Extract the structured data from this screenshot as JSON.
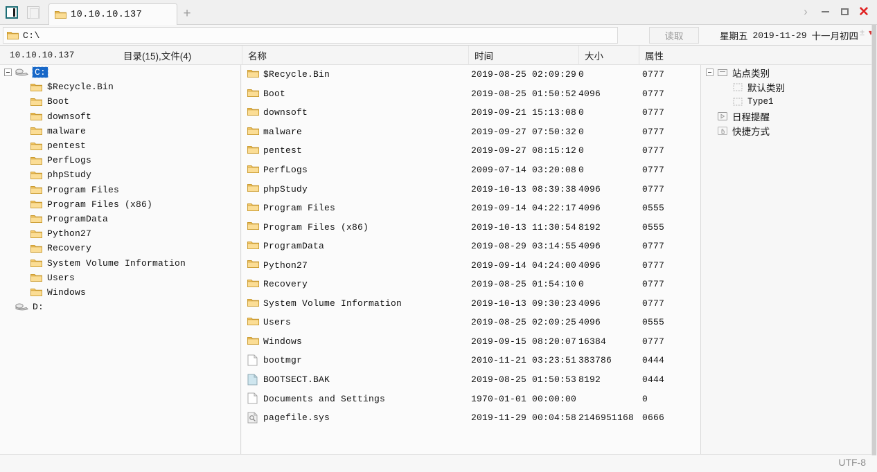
{
  "titlebar": {
    "panel_toggle_icon": "panel-left-icon",
    "panel_toggle2_icon": "panel-right-icon",
    "tab_icon": "folder-icon",
    "tab_label": "10.10.10.137",
    "new_tab_label": "+",
    "chevron_icon": "chevron-right-icon",
    "minimize_label": "minimize-icon",
    "maximize_label": "maximize-icon",
    "close_label": "✕"
  },
  "address": {
    "folder_icon": "folder-icon",
    "path": "C:\\",
    "plusminus": "±",
    "caret": "▾",
    "read_button": "读取"
  },
  "datebar": {
    "weekday": "星期五",
    "date": "2019-11-29",
    "lunar": "十一月初四"
  },
  "columns": {
    "host": "10.10.10.137",
    "counts": "目录(15),文件(4)",
    "name": "名称",
    "time": "时间",
    "size": "大小",
    "attr": "属性"
  },
  "tree": {
    "root": {
      "label": "C:",
      "icon": "drive-icon",
      "selected": true
    },
    "children": [
      {
        "label": "$Recycle.Bin",
        "icon": "folder-icon"
      },
      {
        "label": "Boot",
        "icon": "folder-icon"
      },
      {
        "label": "downsoft",
        "icon": "folder-icon"
      },
      {
        "label": "malware",
        "icon": "folder-icon"
      },
      {
        "label": "pentest",
        "icon": "folder-icon"
      },
      {
        "label": "PerfLogs",
        "icon": "folder-icon"
      },
      {
        "label": "phpStudy",
        "icon": "folder-icon"
      },
      {
        "label": "Program Files",
        "icon": "folder-icon"
      },
      {
        "label": "Program Files (x86)",
        "icon": "folder-icon"
      },
      {
        "label": "ProgramData",
        "icon": "folder-icon"
      },
      {
        "label": "Python27",
        "icon": "folder-icon"
      },
      {
        "label": "Recovery",
        "icon": "folder-icon"
      },
      {
        "label": "System Volume Information",
        "icon": "folder-icon"
      },
      {
        "label": "Users",
        "icon": "folder-icon"
      },
      {
        "label": "Windows",
        "icon": "folder-icon"
      }
    ],
    "drive_d": {
      "label": "D:",
      "icon": "drive-icon"
    }
  },
  "files": [
    {
      "icon": "folder-icon",
      "name": "$Recycle.Bin",
      "time": "2019-08-25 02:09:29",
      "size": "0",
      "attr": "0777"
    },
    {
      "icon": "folder-icon",
      "name": "Boot",
      "time": "2019-08-25 01:50:52",
      "size": "4096",
      "attr": "0777"
    },
    {
      "icon": "folder-icon",
      "name": "downsoft",
      "time": "2019-09-21 15:13:08",
      "size": "0",
      "attr": "0777"
    },
    {
      "icon": "folder-icon",
      "name": "malware",
      "time": "2019-09-27 07:50:32",
      "size": "0",
      "attr": "0777"
    },
    {
      "icon": "folder-icon",
      "name": "pentest",
      "time": "2019-09-27 08:15:12",
      "size": "0",
      "attr": "0777"
    },
    {
      "icon": "folder-icon",
      "name": "PerfLogs",
      "time": "2009-07-14 03:20:08",
      "size": "0",
      "attr": "0777"
    },
    {
      "icon": "folder-icon",
      "name": "phpStudy",
      "time": "2019-10-13 08:39:38",
      "size": "4096",
      "attr": "0777"
    },
    {
      "icon": "folder-icon",
      "name": "Program Files",
      "time": "2019-09-14 04:22:17",
      "size": "4096",
      "attr": "0555"
    },
    {
      "icon": "folder-icon",
      "name": "Program Files (x86)",
      "time": "2019-10-13 11:30:54",
      "size": "8192",
      "attr": "0555"
    },
    {
      "icon": "folder-icon",
      "name": "ProgramData",
      "time": "2019-08-29 03:14:55",
      "size": "4096",
      "attr": "0777"
    },
    {
      "icon": "folder-icon",
      "name": "Python27",
      "time": "2019-09-14 04:24:00",
      "size": "4096",
      "attr": "0777"
    },
    {
      "icon": "folder-icon",
      "name": "Recovery",
      "time": "2019-08-25 01:54:10",
      "size": "0",
      "attr": "0777"
    },
    {
      "icon": "folder-icon",
      "name": "System Volume Information",
      "time": "2019-10-13 09:30:23",
      "size": "4096",
      "attr": "0777"
    },
    {
      "icon": "folder-icon",
      "name": "Users",
      "time": "2019-08-25 02:09:25",
      "size": "4096",
      "attr": "0555"
    },
    {
      "icon": "folder-icon",
      "name": "Windows",
      "time": "2019-09-15 08:20:07",
      "size": "16384",
      "attr": "0777"
    },
    {
      "icon": "file-icon",
      "name": "bootmgr",
      "time": "2010-11-21 03:23:51",
      "size": "383786",
      "attr": "0444"
    },
    {
      "icon": "file-backup-icon",
      "name": "BOOTSECT.BAK",
      "time": "2019-08-25 01:50:53",
      "size": "8192",
      "attr": "0444"
    },
    {
      "icon": "file-icon",
      "name": "Documents and Settings",
      "time": "1970-01-01 00:00:00",
      "size": "",
      "attr": "0"
    },
    {
      "icon": "file-system-icon",
      "name": "pagefile.sys",
      "time": "2019-11-29 00:04:58",
      "size": "2146951168",
      "attr": "0666"
    }
  ],
  "sidepanel": [
    {
      "label": "站点类别",
      "icon": "category-icon",
      "level": 0,
      "expander": true,
      "mono": false
    },
    {
      "label": "默认类别",
      "icon": "dotted-box-icon",
      "level": 2,
      "expander": false,
      "mono": false
    },
    {
      "label": "Type1",
      "icon": "dotted-box-icon",
      "level": 2,
      "expander": false,
      "mono": true
    },
    {
      "label": "日程提醒",
      "icon": "schedule-icon",
      "level": 1,
      "expander": false,
      "mono": false
    },
    {
      "label": "快捷方式",
      "icon": "shortcut-icon",
      "level": 1,
      "expander": false,
      "mono": false
    }
  ],
  "footer": {
    "encoding": "UTF-8"
  },
  "colors": {
    "folder": "#f5c96a",
    "accent_teal": "#1d6e76",
    "close_red": "#e02020",
    "selection_blue": "#1868c8"
  }
}
